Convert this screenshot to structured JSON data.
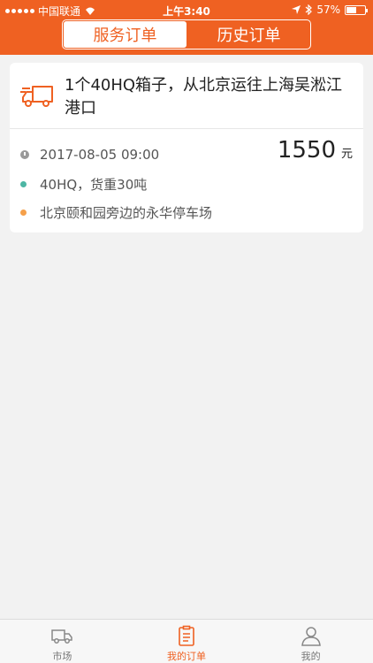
{
  "status_bar": {
    "carrier": "中国联通",
    "time": "上午3:40",
    "battery": "57%",
    "battery_level": 0.57
  },
  "segment": {
    "tabs": [
      "服务订单",
      "历史订单"
    ],
    "active_index": 0
  },
  "order": {
    "title": "1个40HQ箱子，从北京运往上海吴淞江港口",
    "datetime": "2017-08-05 09:00",
    "cargo": "40HQ，货重30吨",
    "location": "北京颐和园旁边的永华停车场",
    "price": "1550",
    "price_unit": "元"
  },
  "tabbar": {
    "items": [
      "市场",
      "我的订单",
      "我的"
    ],
    "active_index": 1
  },
  "colors": {
    "accent": "#ef6122",
    "cargo_dot": "#4db6a4",
    "location_dot": "#f5a04a"
  }
}
